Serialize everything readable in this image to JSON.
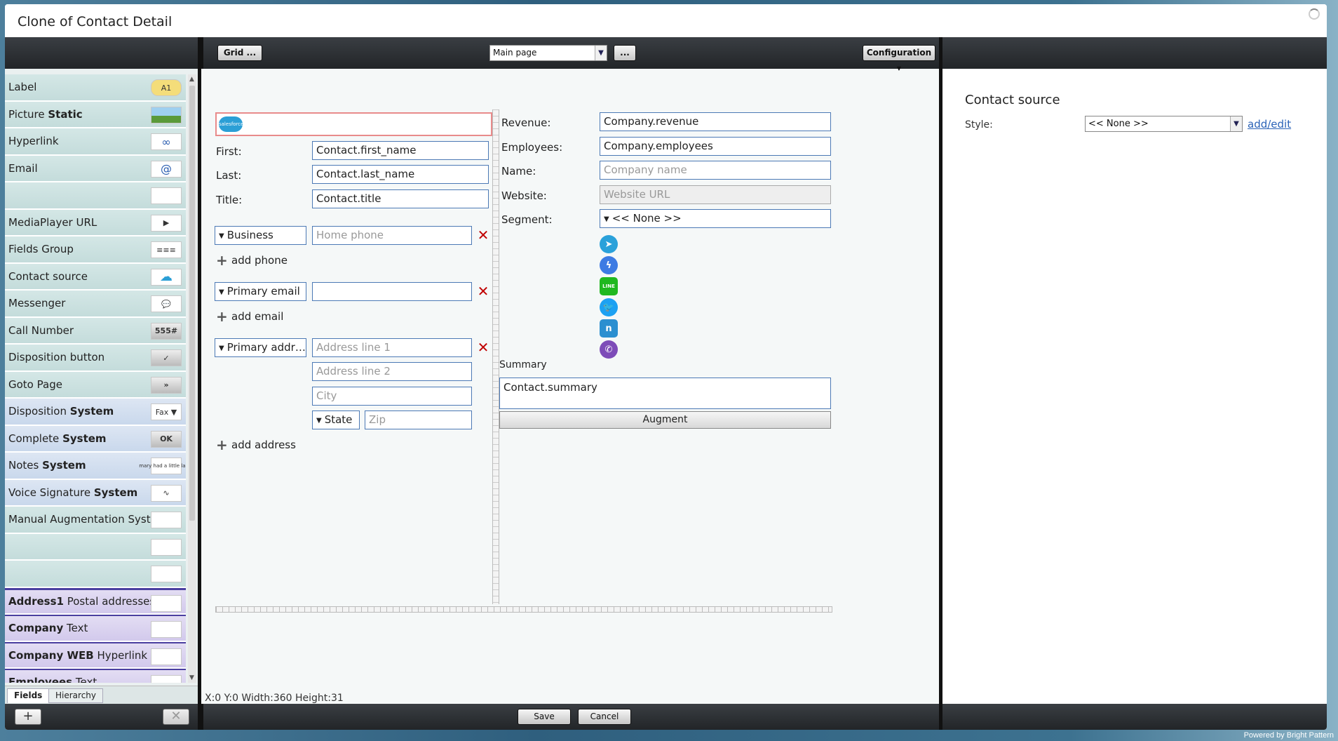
{
  "window": {
    "title": "Clone of Contact Detail",
    "powered_by": "Powered by Bright Pattern"
  },
  "palette": {
    "items": [
      {
        "label": "Label",
        "bold": "",
        "icon": "label-icon",
        "icon_text": "A1"
      },
      {
        "label": "Picture ",
        "bold": "Static",
        "icon": "picture-icon",
        "icon_text": ""
      },
      {
        "label": "Hyperlink",
        "bold": "",
        "icon": "hyperlink-icon",
        "icon_text": "∞"
      },
      {
        "label": "Email",
        "bold": "",
        "icon": "email-icon",
        "icon_text": "@"
      },
      {
        "label": "",
        "bold": "",
        "icon": "blank-icon",
        "icon_text": ""
      },
      {
        "label": "MediaPlayer URL",
        "bold": "",
        "icon": "play-icon",
        "icon_text": "▶"
      },
      {
        "label": "Fields Group",
        "bold": "",
        "icon": "fields-group-icon",
        "icon_text": "≡≡≡"
      },
      {
        "label": "Contact source",
        "bold": "",
        "icon": "contact-source-icon",
        "icon_text": "☁"
      },
      {
        "label": "Messenger",
        "bold": "",
        "icon": "messenger-icon",
        "icon_text": "💬"
      },
      {
        "label": "Call Number",
        "bold": "",
        "icon": "call-number-icon",
        "icon_text": "555#"
      },
      {
        "label": "Disposition button",
        "bold": "",
        "icon": "checkmark-icon",
        "icon_text": "✓"
      },
      {
        "label": "Goto Page",
        "bold": "",
        "icon": "goto-icon",
        "icon_text": "»"
      },
      {
        "label": "Disposition ",
        "bold": "System",
        "icon": "fax-dropdown-icon",
        "icon_text": "Fax ▼"
      },
      {
        "label": "Complete ",
        "bold": "System",
        "icon": "ok-icon",
        "icon_text": "OK"
      },
      {
        "label": "Notes ",
        "bold": "System",
        "icon": "notes-icon",
        "icon_text": "mary had a little lamb"
      },
      {
        "label": "Voice Signature ",
        "bold": "System",
        "icon": "waveform-icon",
        "icon_text": "∿"
      },
      {
        "label": "Manual Augmentation Syst…",
        "bold": "",
        "icon": "blank-icon",
        "icon_text": ""
      },
      {
        "label": "",
        "bold": "",
        "icon": "blank-icon",
        "icon_text": ""
      },
      {
        "label": "",
        "bold": "",
        "icon": "blank-icon",
        "icon_text": ""
      },
      {
        "label": " Postal addresses",
        "bold": "Address1",
        "icon": "blank-icon",
        "icon_text": ""
      },
      {
        "label": " Text",
        "bold": "Company",
        "icon": "blank-icon",
        "icon_text": ""
      },
      {
        "label": " Hyperlink",
        "bold": "Company WEB",
        "icon": "blank-icon",
        "icon_text": ""
      },
      {
        "label": " Text",
        "bold": "Employees",
        "icon": "blank-icon",
        "icon_text": ""
      }
    ],
    "tabs": [
      "Fields",
      "Hierarchy"
    ],
    "add_label": "+",
    "remove_label": "✕"
  },
  "toolbar": {
    "grid_label": "Grid ...",
    "page_select": "Main page",
    "more_label": "...",
    "config_label": "Configuration"
  },
  "form": {
    "first_label": "First:",
    "first_value": "Contact.first_name",
    "last_label": "Last:",
    "last_value": "Contact.last_name",
    "title_label": "Title:",
    "title_value": "Contact.title",
    "phone_type": "Business",
    "phone_placeholder": "Home phone",
    "add_phone": "add phone",
    "email_type": "Primary email",
    "email_value": "",
    "add_email": "add email",
    "address_type": "Primary addr…",
    "address1_placeholder": "Address line 1",
    "address2_placeholder": "Address line 2",
    "city_placeholder": "City",
    "state_label": "State",
    "zip_placeholder": "Zip",
    "add_address": "add address",
    "revenue_label": "Revenue:",
    "revenue_value": "Company.revenue",
    "employees_label": "Employees:",
    "employees_value": "Company.employees",
    "name_label": "Name:",
    "name_placeholder": "Company name",
    "website_label": "Website:",
    "website_placeholder": "Website URL",
    "segment_label": "Segment:",
    "segment_value": "<< None >>",
    "summary_label": "Summary",
    "summary_value": "Contact.summary",
    "augment_label": "Augment",
    "salesforce_text": "salesforce"
  },
  "messengers": [
    {
      "name": "telegram-icon",
      "color": "#2aa1da",
      "glyph": "➤"
    },
    {
      "name": "facebook-messenger-icon",
      "color": "#3d7be3",
      "glyph": "ϟ"
    },
    {
      "name": "line-icon",
      "color": "#20b820",
      "glyph": "LINE"
    },
    {
      "name": "twitter-icon",
      "color": "#1da1f2",
      "glyph": "🐦"
    },
    {
      "name": "nexmo-icon",
      "color": "#2b8fd0",
      "glyph": "n"
    },
    {
      "name": "viber-icon",
      "color": "#7d4cb8",
      "glyph": "✆"
    }
  ],
  "status": {
    "coords": "X:0 Y:0 Width:360 Height:31"
  },
  "footer": {
    "save_label": "Save",
    "cancel_label": "Cancel"
  },
  "properties": {
    "title": "Contact source",
    "style_label": "Style:",
    "style_value": "<< None >>",
    "add_edit": "add/edit"
  }
}
